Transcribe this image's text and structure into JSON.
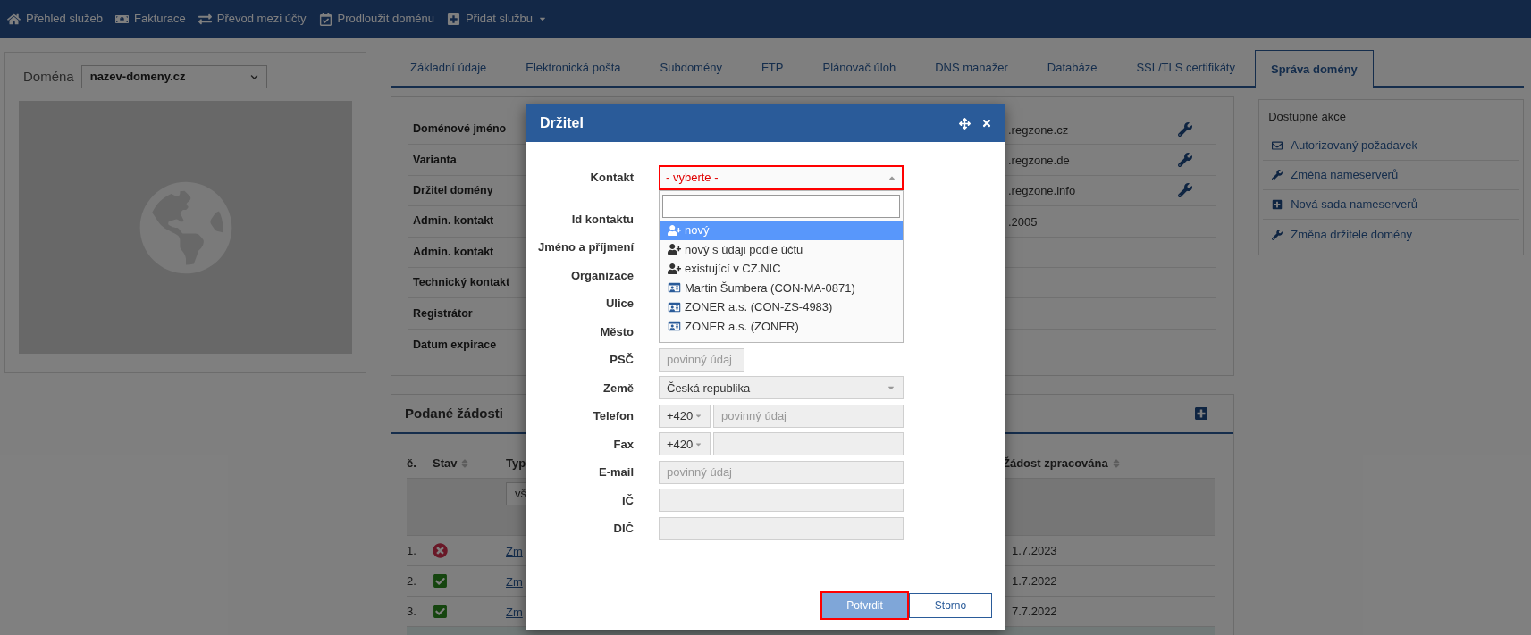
{
  "nav": [
    {
      "label": "Přehled služeb",
      "dropdown": false
    },
    {
      "label": "Fakturace",
      "dropdown": false
    },
    {
      "label": "Převod mezi účty",
      "dropdown": false
    },
    {
      "label": "Prodloužit doménu",
      "dropdown": false
    },
    {
      "label": "Přidat službu",
      "dropdown": true
    }
  ],
  "domain_picker": {
    "label": "Doména",
    "value": "nazev-domeny.cz"
  },
  "tabs": [
    {
      "label": "Základní údaje",
      "selected": false
    },
    {
      "label": "Elektronická pošta",
      "selected": false
    },
    {
      "label": "Subdomény",
      "selected": false
    },
    {
      "label": "FTP",
      "selected": false
    },
    {
      "label": "Plánovač úloh",
      "selected": false
    },
    {
      "label": "DNS manažer",
      "selected": false
    },
    {
      "label": "Databáze",
      "selected": false
    },
    {
      "label": "SSL/TLS certifikáty",
      "selected": false
    },
    {
      "label": "Správa domény",
      "selected": true
    }
  ],
  "details": [
    {
      "label": "Doménové jméno",
      "value": ".regzone.cz",
      "editable": true
    },
    {
      "label": "Varianta",
      "value": ".regzone.de",
      "editable": true
    },
    {
      "label": "Držitel domény",
      "value": ".regzone.info",
      "editable": true
    },
    {
      "label": "Admin. kontakt",
      "value": ".2005",
      "editable": false
    },
    {
      "label": "Admin. kontakt",
      "editable": false
    },
    {
      "label": "Technický kontakt",
      "editable": false
    },
    {
      "label": "Registrátor",
      "editable": false
    },
    {
      "label": "Datum expirace",
      "editable": false
    }
  ],
  "actions_panel": {
    "title": "Dostupné akce",
    "items": [
      {
        "label": "Autorizovaný požadavek"
      },
      {
        "label": "Změna nameserverů"
      },
      {
        "label": "Nová sada nameserverů"
      },
      {
        "label": "Změna držitele domény"
      }
    ]
  },
  "requests": {
    "title": "Podané žádosti",
    "columns": [
      {
        "label": "č.",
        "sortable": false
      },
      {
        "label": "Stav",
        "sortable": true
      },
      {
        "label": "Typ",
        "sortable": false
      },
      {
        "label": "Žádost zpracována",
        "sortable": true
      }
    ],
    "filter": {
      "value": "vš"
    },
    "rows": [
      {
        "number": "1.",
        "kind": "rejected",
        "type": "Zm",
        "processed": "1.7.2023"
      },
      {
        "number": "2.",
        "kind": "done",
        "type": "Zm",
        "processed": "1.7.2022"
      },
      {
        "number": "3.",
        "kind": "done",
        "type": "Zm",
        "processed": "7.7.2022"
      }
    ]
  },
  "dialog": {
    "title": "Držitel",
    "fields": [
      {
        "label": "Kontakt",
        "kind": "select",
        "value": "- vyberte -",
        "invalid": true
      },
      {
        "label": "Id kontaktu",
        "kind": "covered"
      },
      {
        "label": "Jméno a příjmení",
        "kind": "covered"
      },
      {
        "label": "Organizace",
        "kind": "covered"
      },
      {
        "label": "Ulice",
        "kind": "covered"
      },
      {
        "label": "Město",
        "kind": "covered"
      },
      {
        "label": "PSČ",
        "kind": "short",
        "placeholder": "povinný údaj"
      },
      {
        "label": "Země",
        "kind": "select",
        "value": "Česká republika",
        "invalid": false
      },
      {
        "label": "Telefon",
        "kind": "phone",
        "prefix": "+420",
        "placeholder": "povinný údaj"
      },
      {
        "label": "Fax",
        "kind": "phone",
        "prefix": "+420"
      },
      {
        "label": "E-mail",
        "kind": "text",
        "placeholder": "povinný údaj"
      },
      {
        "label": "IČ",
        "kind": "text"
      },
      {
        "label": "DIČ",
        "kind": "text"
      }
    ],
    "dropdown": {
      "options": [
        {
          "label": "nový",
          "kind": "new",
          "selected": true
        },
        {
          "label": "nový s údaji podle účtu",
          "kind": "new",
          "selected": false
        },
        {
          "label": "existující v CZ.NIC",
          "kind": "new",
          "selected": false
        },
        {
          "label": "Martin Šumbera (CON-MA-0871)",
          "kind": "contact",
          "selected": false
        },
        {
          "label": "ZONER a.s. (CON-ZS-4983)",
          "kind": "contact",
          "selected": false
        },
        {
          "label": "ZONER a.s. (ZONER)",
          "kind": "contact",
          "selected": false
        }
      ]
    },
    "buttons": [
      {
        "label": "Potvrdit",
        "kind": "primary",
        "highlighted": true,
        "disabled": true
      },
      {
        "label": "Storno",
        "kind": "secondary",
        "highlighted": false,
        "disabled": false
      }
    ]
  }
}
